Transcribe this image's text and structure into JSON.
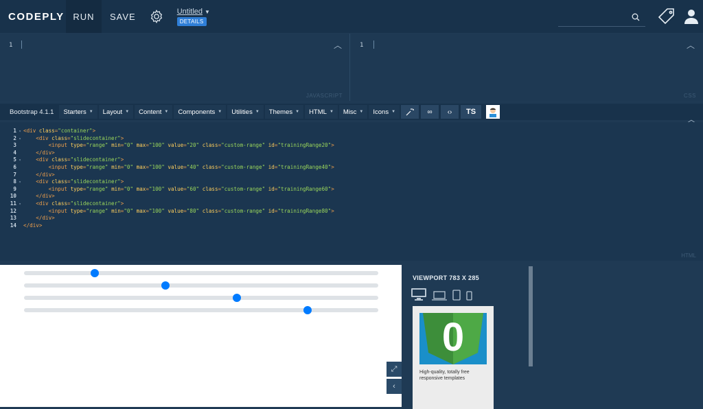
{
  "nav": {
    "brand": "CODEPLY",
    "run": "RUN",
    "save": "SAVE",
    "title": "Untitled",
    "details": "DETAILS"
  },
  "js_panel": {
    "line": "1",
    "label": "JAVASCRIPT"
  },
  "css_panel": {
    "line": "1",
    "label": "CSS"
  },
  "toolbar": {
    "framework": "Bootstrap 4.1.1",
    "menus": [
      "Starters",
      "Layout",
      "Content",
      "Components",
      "Utilities",
      "Themes",
      "HTML",
      "Misc",
      "Icons"
    ],
    "ts": "TS",
    "icons": [
      "magic-wand-icon",
      "infinity-icon",
      "code-brackets-icon",
      "ts-button",
      "avatar-icon"
    ]
  },
  "html_editor": {
    "label": "HTML",
    "line_numbers": [
      "1",
      "2",
      "3",
      "4",
      "5",
      "6",
      "7",
      "8",
      "9",
      "10",
      "11",
      "12",
      "13",
      "14"
    ]
  },
  "preview": {
    "slider_values": [
      20,
      40,
      60,
      80
    ],
    "slider_min": 0,
    "slider_max": 100,
    "accent": "#007bff"
  },
  "viewport": {
    "title": "VIEWPORT 783 X 285",
    "devices": [
      "desktop-icon",
      "laptop-icon",
      "tablet-icon",
      "phone-icon"
    ]
  },
  "ad": {
    "logo_text": "0",
    "text": "High-quality, totally free responsive templates"
  },
  "colors": {
    "nav_bg": "#18324b",
    "editor_bg": "#1b3650",
    "tag": "#f0a04b",
    "attr": "#ffcf5c",
    "string": "#9ad65b"
  }
}
